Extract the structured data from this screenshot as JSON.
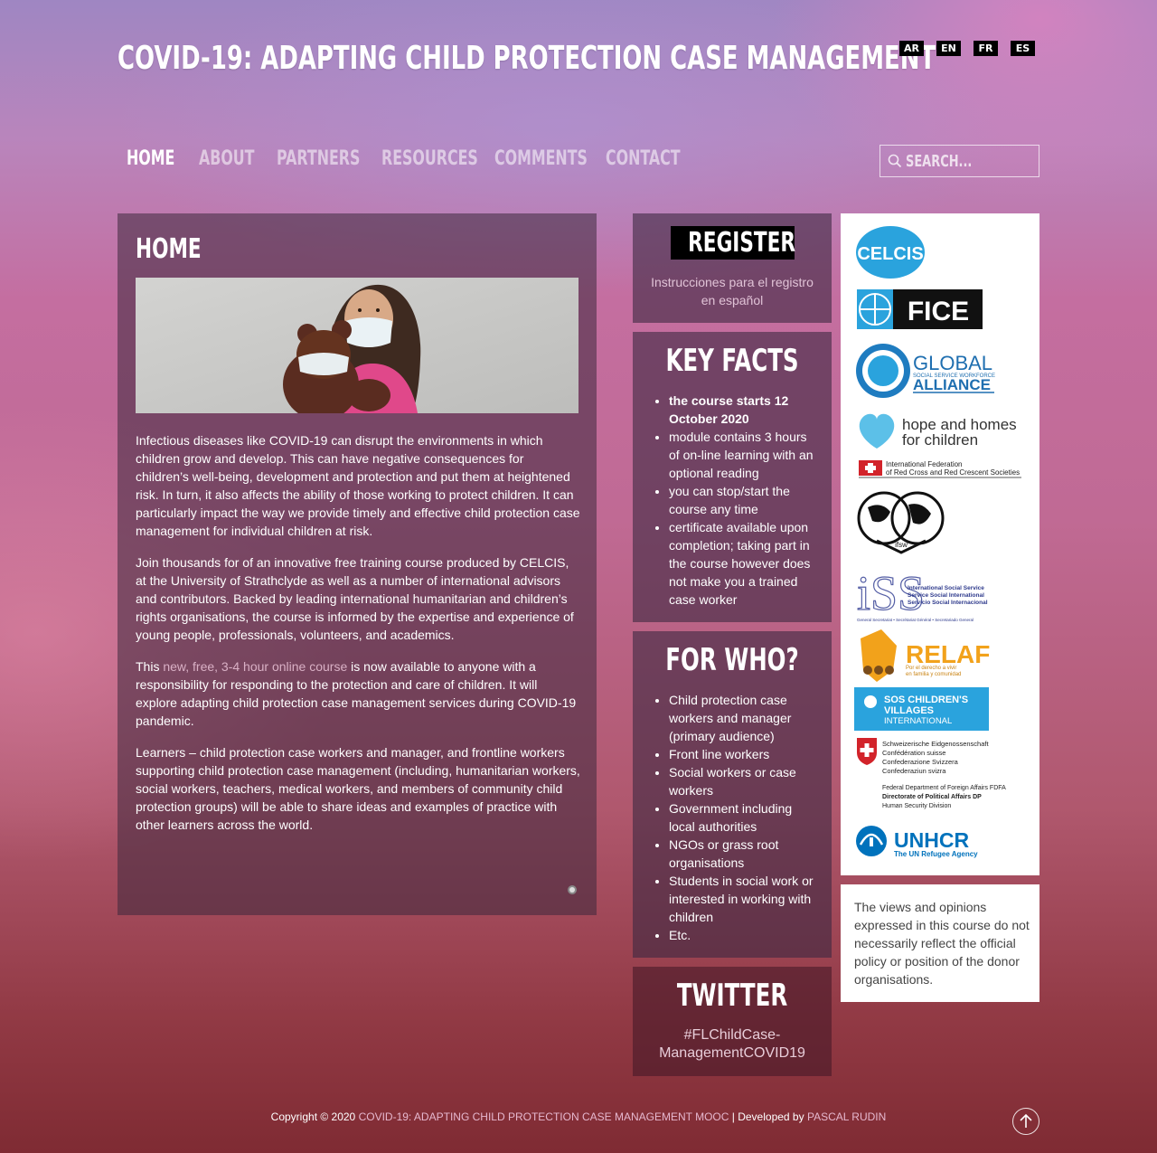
{
  "header": {
    "site_title": "COVID-19: ADAPTING CHILD PROTECTION CASE MANAGEMENT",
    "languages": [
      "AR",
      "EN",
      "FR",
      "ES"
    ]
  },
  "nav": {
    "items": [
      {
        "label": "HOME",
        "active": true
      },
      {
        "label": "ABOUT",
        "active": false
      },
      {
        "label": "PARTNERS",
        "active": false
      },
      {
        "label": "RESOURCES",
        "active": false
      },
      {
        "label": "COMMENTS",
        "active": false
      },
      {
        "label": "CONTACT",
        "active": false
      }
    ],
    "search_placeholder": "SEARCH..."
  },
  "main": {
    "title": "HOME",
    "paragraph1": "Infectious diseases like COVID-19 can disrupt the environments in which children grow and develop. This can have negative consequences for children’s well-being, development and protection and put them at heightened risk. In turn, it also affects the ability of those working to protect children. It can particularly impact the way we provide timely and effective child protection case management for individual children at risk.",
    "paragraph2": "Join thousands for of an innovative free training course produced by CELCIS, at the University of Strathclyde as well as a number of international advisors and contributors. Backed by leading international humanitarian and children’s rights organisations, the course is informed by the expertise and experience of young people, professionals, volunteers, and academics.",
    "paragraph3_prefix": "This ",
    "paragraph3_link": "new, free, 3-4 hour online course",
    "paragraph3_suffix": " is now available to anyone with a responsibility for responding to the protection and care of children. It will explore adapting child protection case management services during COVID-19 pandemic.",
    "paragraph4": "Learners – child protection case workers and manager, and frontline workers supporting child protection case management (including, humanitarian workers, social workers, teachers, medical workers, and  members of community child protection groups) will be able to share ideas and examples of practice with other learners across the world."
  },
  "register": {
    "button_label": "REGISTER",
    "spanish_link": "Instrucciones para el registro en español"
  },
  "key_facts": {
    "title": "KEY FACTS",
    "items": [
      "the course starts 12 October 2020",
      "module contains 3 hours of on-line learning with an optional reading",
      "you can stop/start the course any time",
      "certificate available upon completion; taking part in the course however does not make you a trained case worker"
    ]
  },
  "for_who": {
    "title": "FOR WHO?",
    "items": [
      "Child protection case workers and manager (primary audience)",
      "Front line workers",
      "Social workers or case workers",
      "Government including local authorities",
      "NGOs or grass root organisations",
      "Students in social work or interested in working with children",
      "Etc."
    ]
  },
  "twitter": {
    "title": "TWITTER",
    "hashtag": "#FLChildCase-ManagementCOVID19"
  },
  "sponsors": {
    "celcis": "CELCIS",
    "fice": "FICE",
    "global_alliance_line1": "GLOBAL",
    "global_alliance_line2": "SOCIAL SERVICE WORKFORCE",
    "global_alliance_line3": "ALLIANCE",
    "hope_line1": "hope and homes",
    "hope_line2": "for children",
    "ifrc_line1": "International Federation",
    "ifrc_line2": "of Red Cross and Red Crescent Societies",
    "ifsw": "ifsw",
    "iss_line1": "International Social Service",
    "iss_line2": "Service Social International",
    "iss_line3": "Servicio Social Internacional",
    "iss_line4": "General Secretariat • Secrétariat Général • Secretariado General",
    "relaf": "RELAF",
    "relaf_tag1": "Por el derecho a vivir",
    "relaf_tag2": "en familia y comunidad",
    "sos_line1": "SOS CHILDREN'S",
    "sos_line2": "VILLAGES",
    "sos_line3": "INTERNATIONAL",
    "swiss_line1": "Schweizerische Eidgenossenschaft",
    "swiss_line2": "Confédération suisse",
    "swiss_line3": "Confederazione Svizzera",
    "swiss_line4": "Confederaziun svizra",
    "fdfa_line1": "Federal Department of Foreign Affairs FDFA",
    "fdfa_line2": "Directorate of Political Affairs DP",
    "fdfa_line3": "Human Security Division",
    "unhcr": "UNHCR",
    "unhcr_tag": "The UN Refugee Agency"
  },
  "disclaimer": "The views and opinions expressed in this course do not necessarily reflect the official policy or position of the donor organisations.",
  "footer": {
    "copyright": "Copyright © 2020",
    "site_link": "COVID-19: ADAPTING CHILD PROTECTION CASE MANAGEMENT MOOC",
    "developed_by": "| Developed by",
    "developer_link": "PASCAL RUDIN"
  },
  "colors": {
    "accent_link": "#d9b0c5",
    "panel_overlay": "#3c283c",
    "black_button": "#000000"
  }
}
